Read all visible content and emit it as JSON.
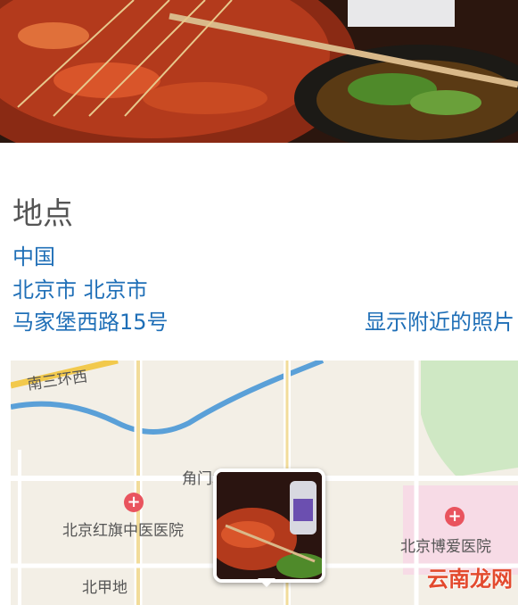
{
  "location": {
    "section_title": "地点",
    "country": "中国",
    "city": "北京市 北京市",
    "street": "马家堡西路15号",
    "nearby_link": "显示附近的照片"
  },
  "map": {
    "labels": {
      "road_south3": "南三环西",
      "jiaomen": "角门北路",
      "hospital_hongqi": "北京红旗中医医院",
      "hospital_boai": "北京博爱医院",
      "beijiadi": "北甲地"
    }
  },
  "watermark": "云南龙网",
  "colors": {
    "link": "#1f6fb7",
    "title": "#555555",
    "map_bg": "#f3efe6",
    "poi": "#e9545e",
    "river": "#5aa0d8"
  }
}
